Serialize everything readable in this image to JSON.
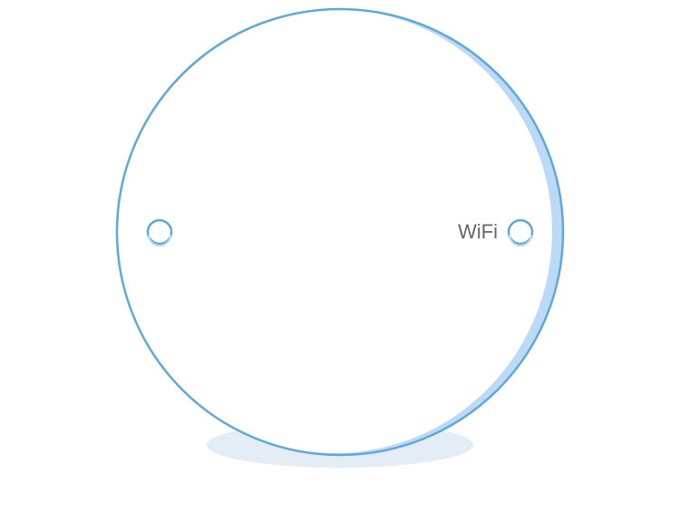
{
  "device": {
    "name": "mesh-router-top-view",
    "port_labels": {
      "left": "",
      "right": "WiFi"
    },
    "colors": {
      "outline": "#5fa8da",
      "rim_shade": "#bcdaf5",
      "shadow": "#e4ecf6",
      "label": "#666666",
      "background": "#ffffff"
    },
    "icons": {
      "left_port": "indicator-ring-icon",
      "right_port": "indicator-ring-icon"
    }
  }
}
